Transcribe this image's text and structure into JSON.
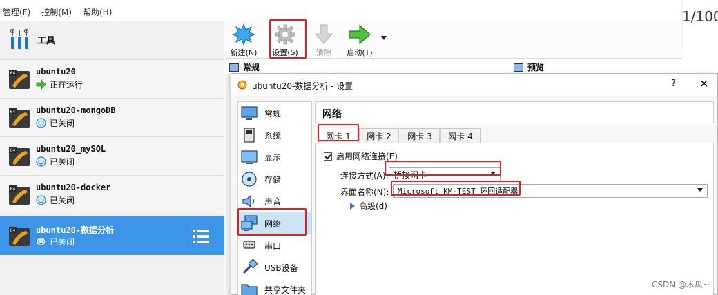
{
  "menubar": {
    "items": [
      "管理(F)",
      "控制(M)",
      "帮助(H)"
    ]
  },
  "sidebar": {
    "tools_label": "工具",
    "vms": [
      {
        "name": "ubuntu20",
        "status": "正在运行",
        "state": "running"
      },
      {
        "name": "ubuntu20-mongoDB",
        "status": "已关闭",
        "state": "off"
      },
      {
        "name": "ubuntu20_mySQL",
        "status": "已关闭",
        "state": "off"
      },
      {
        "name": "ubuntu20-docker",
        "status": "已关闭",
        "state": "off"
      },
      {
        "name": "ubuntu20-数据分析",
        "status": "已关闭",
        "state": "off",
        "selected": true
      }
    ]
  },
  "toolbar": {
    "new_label": "新建(N)",
    "settings_label": "设置(S)",
    "discard_label": "清除",
    "start_label": "启动(T)"
  },
  "details": {
    "general_header": "常规",
    "preview_header": "预览"
  },
  "background": {
    "counter": "1/100"
  },
  "dialog": {
    "title": "ubuntu20-数据分析 - 设置",
    "help": "?",
    "close": "✕",
    "categories": [
      {
        "label": "常规",
        "icon": "general-icon"
      },
      {
        "label": "系统",
        "icon": "system-icon"
      },
      {
        "label": "显示",
        "icon": "display-icon"
      },
      {
        "label": "存储",
        "icon": "storage-icon"
      },
      {
        "label": "声音",
        "icon": "audio-icon"
      },
      {
        "label": "网络",
        "icon": "network-icon",
        "selected": true
      },
      {
        "label": "串口",
        "icon": "serial-port-icon"
      },
      {
        "label": "USB设备",
        "icon": "usb-icon"
      },
      {
        "label": "共享文件夹",
        "icon": "shared-folder-icon"
      }
    ],
    "pane_title": "网络",
    "tabs": [
      "网卡 1",
      "网卡 2",
      "网卡 3",
      "网卡 4"
    ],
    "enable_label": "启用网络连接(E)",
    "attached_label": "连接方式(A):",
    "attached_value": "桥接网卡",
    "name_label": "界面名称(N):",
    "name_value": "Microsoft KM-TEST 环回适配器",
    "advanced_label": "高级(d)"
  },
  "watermark": "CSDN @木瓜~",
  "colors": {
    "selection_blue": "#3c95e6",
    "highlight_red": "#e02020"
  }
}
